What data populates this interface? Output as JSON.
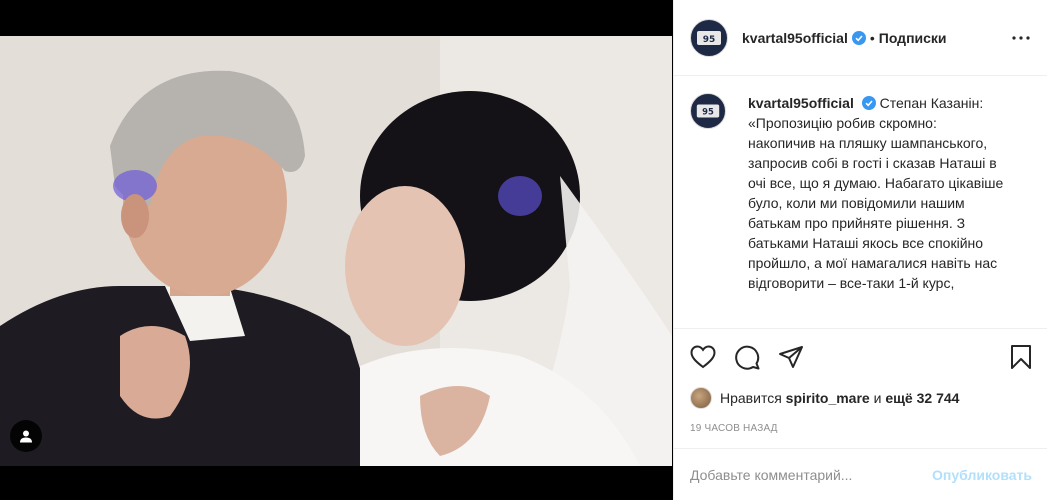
{
  "post": {
    "username": "kvartal95official",
    "follow_label": "Подписки",
    "separator": "•",
    "verified": true,
    "avatar_label": "95"
  },
  "caption": {
    "username": "kvartal95official",
    "text": "Степан Казанін: «Пропозицію робив скромно: накопичив на пляшку шампанського, запросив собі в гості і сказав Наташі в очі все, що я думаю. Набагато цікавіше було, коли ми повідомили нашим батькам про прийняте рішення. З батьками Наташі якось все спокійно пройшло, а мої намагалися навіть нас відговорити – все-таки 1-й курс,"
  },
  "likes": {
    "prefix": "Нравится",
    "first_liker": "spirito_mare",
    "conjunction": "и",
    "others": "ещё 32 744"
  },
  "timestamp": "19 часов назад",
  "comment_box": {
    "placeholder": "Добавьте комментарий...",
    "publish_label": "Опубликовать"
  },
  "icons": {
    "like": "heart-icon",
    "comment": "comment-icon",
    "share": "share-icon",
    "save": "bookmark-icon",
    "more": "more-icon",
    "tag": "user-tag-icon",
    "verified": "verified-badge-icon"
  },
  "colors": {
    "verified_blue": "#3897f0",
    "publish_disabled": "#b2dffc",
    "text_secondary": "#8e8e8e",
    "border": "#efefef"
  }
}
